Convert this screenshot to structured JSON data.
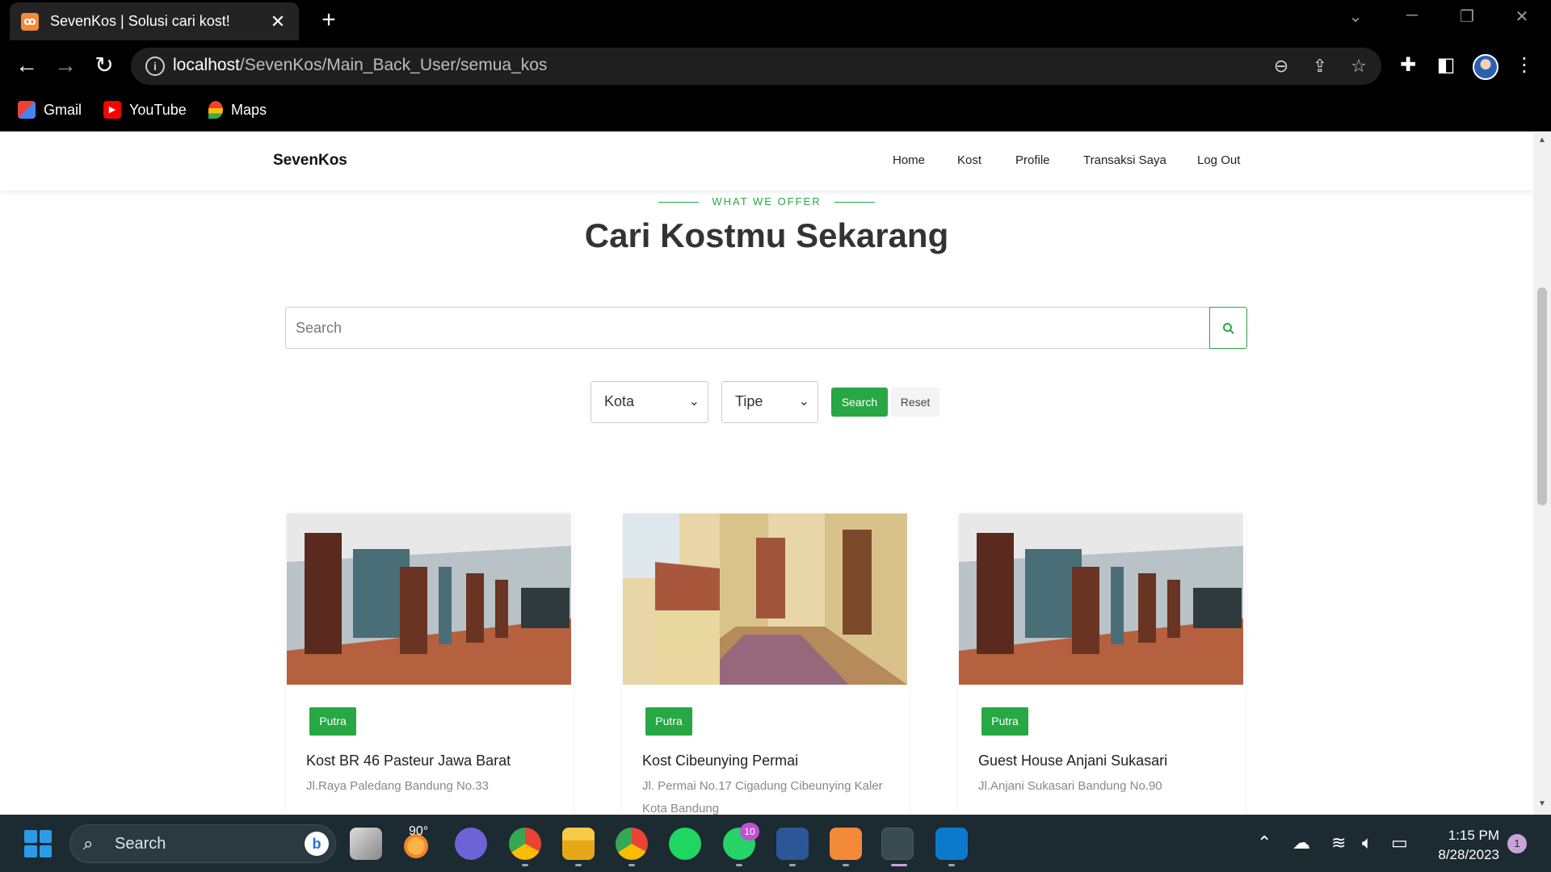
{
  "browser": {
    "tab_title": "SevenKos | Solusi cari kost!",
    "url_host": "localhost",
    "url_path": "/SevenKos/Main_Back_User/semua_kos",
    "bookmarks": [
      {
        "label": "Gmail",
        "icon": "gmail-icon"
      },
      {
        "label": "YouTube",
        "icon": "youtube-icon"
      },
      {
        "label": "Maps",
        "icon": "maps-icon"
      }
    ]
  },
  "site": {
    "brand": "SevenKos",
    "nav": [
      "Home",
      "Kost",
      "Profile",
      "Transaksi Saya",
      "Log Out"
    ],
    "eyebrow": "WHAT WE OFFER",
    "heading": "Cari Kostmu Sekarang",
    "search_placeholder": "Search",
    "filters": {
      "kota": "Kota",
      "tipe": "Tipe",
      "search_button": "Search",
      "reset_button": "Reset"
    },
    "listings": [
      {
        "badge": "Putra",
        "title": "Kost BR 46 Pasteur Jawa Barat",
        "address": "Jl.Raya Paledang Bandung No.33"
      },
      {
        "badge": "Putra",
        "title": "Kost Cibeunying Permai",
        "address": "Jl. Permai No.17 Cigadung Cibeunying Kaler Kota Bandung"
      },
      {
        "badge": "Putra",
        "title": "Guest House Anjani Sukasari",
        "address": "Jl.Anjani Sukasari Bandung No.90"
      }
    ]
  },
  "taskbar": {
    "search_label": "Search",
    "weather": "90°",
    "whatsapp_badge": "10",
    "time": "1:15 PM",
    "date": "8/28/2023",
    "notifications": "1"
  },
  "colors": {
    "accent": "#28a745",
    "chrome_bg": "#000000",
    "taskbar_bg": "#1c2a31"
  }
}
